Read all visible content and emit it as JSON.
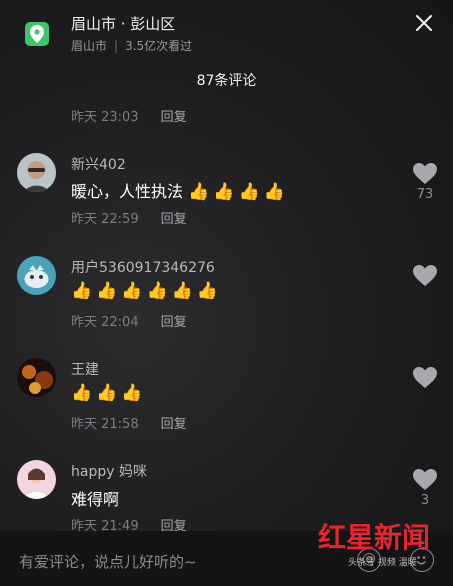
{
  "header": {
    "location_title": "眉山市 · 彭山区",
    "location_city": "眉山市",
    "views": "3.5亿次看过",
    "comment_count": "87条评论"
  },
  "reply_label": "回复",
  "top_partial": {
    "time": "昨天 23:03"
  },
  "comments": [
    {
      "user": "新兴402",
      "text": "暖心，人性执法",
      "emoji": [
        "👍",
        "👍",
        "👍",
        "👍"
      ],
      "time": "昨天 22:59",
      "likes": "73",
      "avatar_color": "#8a6a52"
    },
    {
      "user": "用户5360917346276",
      "text": "",
      "emoji": [
        "👍",
        "👍",
        "👍",
        "👍",
        "👍",
        "👍"
      ],
      "time": "昨天 22:04",
      "likes": "",
      "avatar_color": "#4aa3b8"
    },
    {
      "user": "王建",
      "text": "",
      "emoji": [
        "👍",
        "👍",
        "👍"
      ],
      "time": "昨天 21:58",
      "likes": "",
      "avatar_color": "#7a3a12"
    },
    {
      "user": "happy 妈咪",
      "text": "难得啊",
      "emoji": [],
      "time": "昨天 21:49",
      "likes": "3",
      "avatar_color": "#e6b7c8"
    }
  ],
  "input": {
    "placeholder": "有爱评论，说点儿好听的~"
  },
  "watermark": {
    "brand": "红星新闻",
    "sub": "头条号 视频 温暖"
  },
  "icons": {
    "location": "location-pin-icon",
    "close": "close-icon",
    "like": "heart-icon",
    "mention": "at-icon",
    "emoji": "emoji-icon"
  }
}
